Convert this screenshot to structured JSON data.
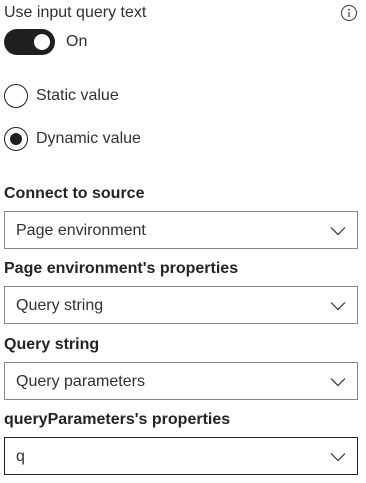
{
  "toggle": {
    "title": "Use input query text",
    "state_label": "On",
    "is_on": true
  },
  "radios": [
    {
      "label": "Static value",
      "selected": false
    },
    {
      "label": "Dynamic value",
      "selected": true
    }
  ],
  "fields": [
    {
      "label": "Connect to source",
      "value": "Page environment"
    },
    {
      "label": "Page environment's properties",
      "value": "Query string"
    },
    {
      "label": "Query string",
      "value": "Query parameters"
    },
    {
      "label": "queryParameters's properties",
      "value": "q"
    }
  ],
  "icons": {
    "info": "info-icon",
    "dropdown": "chevron-down-icon"
  },
  "colors": {
    "toggle_on": "#1f1f1f",
    "text": "#323130",
    "border": "#8a8886"
  }
}
